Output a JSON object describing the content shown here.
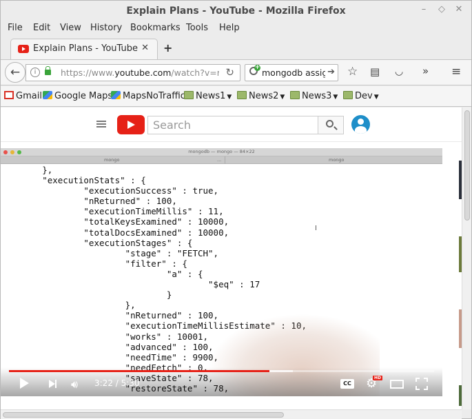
{
  "window": {
    "title": "Explain Plans - YouTube - Mozilla Firefox",
    "minimize": "–",
    "maximize": "◇",
    "close": "✕"
  },
  "menu": [
    "File",
    "Edit",
    "View",
    "History",
    "Bookmarks",
    "Tools",
    "Help"
  ],
  "tab": {
    "title": "Explain Plans - YouTube",
    "close": "✕",
    "new_tab": "+"
  },
  "navbar": {
    "url_prefix": "https://www.",
    "url_host": "youtube.com",
    "url_rest": "/watch?v=r",
    "search_text": "mongodb assign"
  },
  "bookmarks": [
    "Gmail",
    "Google Maps",
    "MapsNoTraffic",
    "News1",
    "News2",
    "News3",
    "Dev"
  ],
  "youtube": {
    "search_placeholder": "Search"
  },
  "terminal": {
    "window_title": "mongodb — mongo — 84×22",
    "tab1": "mongo",
    "tab1_more": "...",
    "tab2": "mongo"
  },
  "code_lines": [
    "        },",
    "        \"executionStats\" : {",
    "                \"executionSuccess\" : true,",
    "                \"nReturned\" : 100,",
    "                \"executionTimeMillis\" : 11,",
    "                \"totalKeysExamined\" : 10000,",
    "                \"totalDocsExamined\" : 10000,",
    "                \"executionStages\" : {",
    "                        \"stage\" : \"FETCH\",",
    "                        \"filter\" : {",
    "                                \"a\" : {",
    "                                        \"$eq\" : 17",
    "                                }",
    "                        },",
    "                        \"nReturned\" : 100,",
    "                        \"executionTimeMillisEstimate\" : 10,",
    "                        \"works\" : 10001,",
    "                        \"advanced\" : 100,",
    "                        \"needTime\" : 9900,",
    "                        \"needFetch\" : 0,",
    "                        \"saveState\" : 78,",
    "                        \"restoreState\" : 78,"
  ],
  "player": {
    "time": "3:22 / 5:30",
    "played_fraction": 0.612,
    "buffered_fraction": 0.667,
    "cc_label": "CC",
    "hd_label": "HD"
  },
  "colors": {
    "youtube_red": "#e62117",
    "avatar_blue": "#1f8fc9",
    "lock_green": "#3aa43a"
  }
}
